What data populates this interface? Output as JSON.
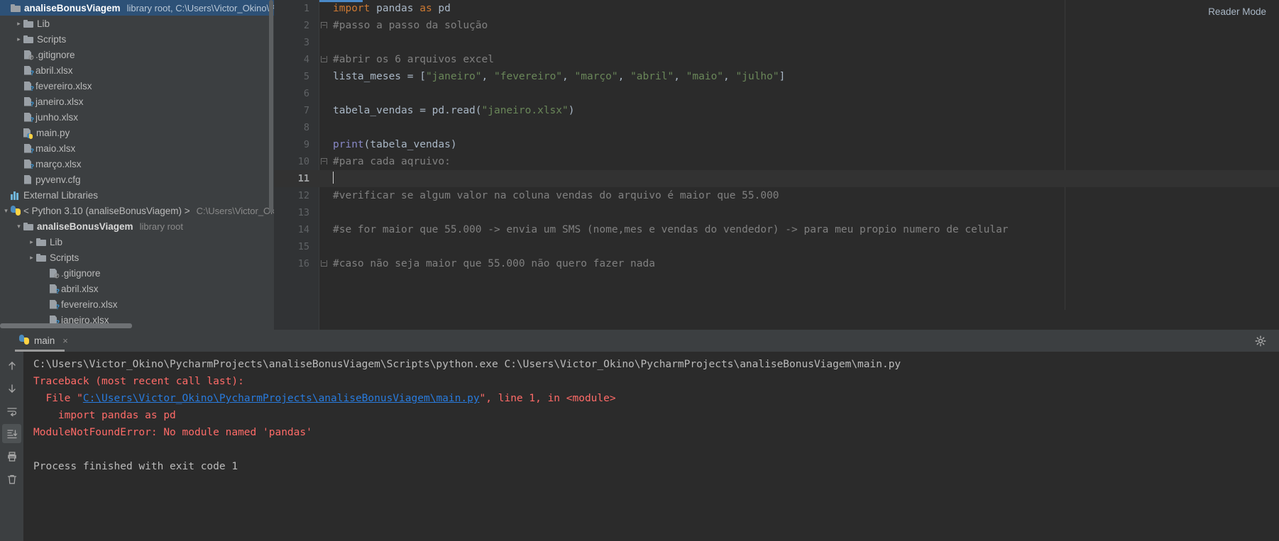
{
  "window": {
    "reader_mode_label": "Reader Mode"
  },
  "sidebar": {
    "rows": [
      {
        "id": "project-root",
        "indent": 0,
        "arrow": "",
        "icon": "folder-icon",
        "label": "analiseBonusViagem",
        "bold": true,
        "sub": "library root,  C:\\Users\\Victor_Okino\\Pycharm",
        "selected": true
      },
      {
        "id": "lib-folder",
        "indent": 1,
        "arrow": "›",
        "icon": "folder-icon",
        "label": "Lib",
        "bold": false,
        "sub": "",
        "selected": false
      },
      {
        "id": "scripts-folder",
        "indent": 1,
        "arrow": "›",
        "icon": "folder-icon",
        "label": "Scripts",
        "bold": false,
        "sub": "",
        "selected": false
      },
      {
        "id": "gitignore-file",
        "indent": 1,
        "arrow": "",
        "icon": "file-ignored-icon",
        "label": ".gitignore",
        "bold": false,
        "sub": "",
        "selected": false
      },
      {
        "id": "abril-xlsx",
        "indent": 1,
        "arrow": "",
        "icon": "file-unknown-icon",
        "label": "abril.xlsx",
        "bold": false,
        "sub": "",
        "selected": false
      },
      {
        "id": "fevereiro-xlsx",
        "indent": 1,
        "arrow": "",
        "icon": "file-unknown-icon",
        "label": "fevereiro.xlsx",
        "bold": false,
        "sub": "",
        "selected": false
      },
      {
        "id": "janeiro-xlsx",
        "indent": 1,
        "arrow": "",
        "icon": "file-unknown-icon",
        "label": "janeiro.xlsx",
        "bold": false,
        "sub": "",
        "selected": false
      },
      {
        "id": "junho-xlsx",
        "indent": 1,
        "arrow": "",
        "icon": "file-unknown-icon",
        "label": "junho.xlsx",
        "bold": false,
        "sub": "",
        "selected": false
      },
      {
        "id": "main-py",
        "indent": 1,
        "arrow": "",
        "icon": "python-file-icon",
        "label": "main.py",
        "bold": false,
        "sub": "",
        "selected": false
      },
      {
        "id": "maio-xlsx",
        "indent": 1,
        "arrow": "",
        "icon": "file-unknown-icon",
        "label": "maio.xlsx",
        "bold": false,
        "sub": "",
        "selected": false
      },
      {
        "id": "marco-xlsx",
        "indent": 1,
        "arrow": "",
        "icon": "file-unknown-icon",
        "label": "março.xlsx",
        "bold": false,
        "sub": "",
        "selected": false
      },
      {
        "id": "pyvenv-cfg",
        "indent": 1,
        "arrow": "",
        "icon": "config-file-icon",
        "label": "pyvenv.cfg",
        "bold": false,
        "sub": "",
        "selected": false
      },
      {
        "id": "external-libraries",
        "indent": 0,
        "arrow": "",
        "icon": "external-libraries-icon",
        "label": "External Libraries",
        "bold": false,
        "sub": "",
        "selected": false
      },
      {
        "id": "python-sdk",
        "indent": 0,
        "arrow": "⌄",
        "icon": "python-icon",
        "label": "< Python 3.10 (analiseBonusViagem) >",
        "bold": false,
        "sub": "C:\\Users\\Victor_Okino",
        "selected": false
      },
      {
        "id": "lib-root-analise",
        "indent": 1,
        "arrow": "⌄",
        "icon": "folder-icon",
        "label": "analiseBonusViagem",
        "bold": true,
        "sub": "library root",
        "selected": false
      },
      {
        "id": "lib-folder-2",
        "indent": 2,
        "arrow": "›",
        "icon": "folder-icon",
        "label": "Lib",
        "bold": false,
        "sub": "",
        "selected": false
      },
      {
        "id": "scripts-folder-2",
        "indent": 2,
        "arrow": "›",
        "icon": "folder-icon",
        "label": "Scripts",
        "bold": false,
        "sub": "",
        "selected": false
      },
      {
        "id": "gitignore-file-2",
        "indent": 3,
        "arrow": "",
        "icon": "file-ignored-icon",
        "label": ".gitignore",
        "bold": false,
        "sub": "",
        "selected": false
      },
      {
        "id": "abril-xlsx-2",
        "indent": 3,
        "arrow": "",
        "icon": "file-unknown-icon",
        "label": "abril.xlsx",
        "bold": false,
        "sub": "",
        "selected": false
      },
      {
        "id": "fevereiro-xlsx-2",
        "indent": 3,
        "arrow": "",
        "icon": "file-unknown-icon",
        "label": "fevereiro.xlsx",
        "bold": false,
        "sub": "",
        "selected": false
      },
      {
        "id": "janeiro-xlsx-2",
        "indent": 3,
        "arrow": "",
        "icon": "file-unknown-icon",
        "label": "janeiro.xlsx",
        "bold": false,
        "sub": "",
        "selected": false
      }
    ]
  },
  "editor": {
    "lines": [
      {
        "num": "1",
        "fold": "",
        "current": false,
        "tokens": [
          {
            "t": "import ",
            "c": "tok-kw"
          },
          {
            "t": "pandas ",
            "c": "tok-def"
          },
          {
            "t": "as ",
            "c": "tok-kw"
          },
          {
            "t": "pd",
            "c": "tok-def"
          }
        ]
      },
      {
        "num": "2",
        "fold": "down",
        "current": false,
        "tokens": [
          {
            "t": "#passo a passo da solução",
            "c": "tok-com"
          }
        ]
      },
      {
        "num": "3",
        "fold": "",
        "current": false,
        "tokens": []
      },
      {
        "num": "4",
        "fold": "up",
        "current": false,
        "tokens": [
          {
            "t": "#abrir os 6 arquivos excel",
            "c": "tok-com"
          }
        ]
      },
      {
        "num": "5",
        "fold": "",
        "current": false,
        "tokens": [
          {
            "t": "lista_meses = [",
            "c": "tok-def"
          },
          {
            "t": "\"janeiro\"",
            "c": "tok-str"
          },
          {
            "t": ", ",
            "c": "tok-def"
          },
          {
            "t": "\"fevereiro\"",
            "c": "tok-str"
          },
          {
            "t": ", ",
            "c": "tok-def"
          },
          {
            "t": "\"março\"",
            "c": "tok-str"
          },
          {
            "t": ", ",
            "c": "tok-def"
          },
          {
            "t": "\"abril\"",
            "c": "tok-str"
          },
          {
            "t": ", ",
            "c": "tok-def"
          },
          {
            "t": "\"maio\"",
            "c": "tok-str"
          },
          {
            "t": ", ",
            "c": "tok-def"
          },
          {
            "t": "\"julho\"",
            "c": "tok-str"
          },
          {
            "t": "]",
            "c": "tok-def"
          }
        ]
      },
      {
        "num": "6",
        "fold": "",
        "current": false,
        "tokens": []
      },
      {
        "num": "7",
        "fold": "",
        "current": false,
        "tokens": [
          {
            "t": "tabela_vendas = pd.read(",
            "c": "tok-def"
          },
          {
            "t": "\"janeiro.xlsx\"",
            "c": "tok-str"
          },
          {
            "t": ")",
            "c": "tok-def"
          }
        ]
      },
      {
        "num": "8",
        "fold": "",
        "current": false,
        "tokens": []
      },
      {
        "num": "9",
        "fold": "",
        "current": false,
        "tokens": [
          {
            "t": "print",
            "c": "tok-fn"
          },
          {
            "t": "(tabela_vendas)",
            "c": "tok-def"
          }
        ]
      },
      {
        "num": "10",
        "fold": "down",
        "current": false,
        "tokens": [
          {
            "t": "#para cada aqruivo:",
            "c": "tok-com"
          }
        ]
      },
      {
        "num": "11",
        "fold": "",
        "current": true,
        "tokens": [],
        "caret": true
      },
      {
        "num": "12",
        "fold": "",
        "current": false,
        "tokens": [
          {
            "t": "#verificar se algum valor na coluna vendas do arquivo é maior que 55.000",
            "c": "tok-com"
          }
        ]
      },
      {
        "num": "13",
        "fold": "",
        "current": false,
        "tokens": []
      },
      {
        "num": "14",
        "fold": "",
        "current": false,
        "tokens": [
          {
            "t": "#se for maior que 55.000 -> envia um SMS (nome,mes e vendas do vendedor) -> para meu propio numero de celular",
            "c": "tok-com"
          }
        ]
      },
      {
        "num": "15",
        "fold": "",
        "current": false,
        "tokens": []
      },
      {
        "num": "16",
        "fold": "up",
        "current": false,
        "tokens": [
          {
            "t": "#caso não seja maior que 55.000 não quero fazer nada",
            "c": "tok-com"
          }
        ]
      }
    ]
  },
  "console": {
    "tab_label": "main",
    "tab_close_label": "×",
    "toolbar": [
      {
        "id": "up-arrow-icon",
        "glyph": "↑",
        "active": false
      },
      {
        "id": "down-arrow-icon",
        "glyph": "↓",
        "active": false
      },
      {
        "id": "soft-wrap-icon",
        "glyph": "↵",
        "active": false
      },
      {
        "id": "scroll-to-end-icon",
        "glyph": "⇩",
        "active": true
      },
      {
        "id": "print-icon",
        "glyph": "⎙",
        "active": false
      },
      {
        "id": "trash-icon",
        "glyph": "Ὕ1",
        "active": false
      }
    ],
    "output": [
      {
        "id": "cmd-line",
        "segments": [
          {
            "t": "C:\\Users\\Victor_Okino\\PycharmProjects\\analiseBonusViagem\\Scripts\\python.exe C:\\Users\\Victor_Okino\\PycharmProjects\\analiseBonusViagem\\main.py",
            "c": "c-gray"
          }
        ]
      },
      {
        "id": "traceback-header",
        "segments": [
          {
            "t": "Traceback (most recent call last):",
            "c": "c-red"
          }
        ]
      },
      {
        "id": "traceback-file",
        "segments": [
          {
            "t": "  File \"",
            "c": "c-red"
          },
          {
            "t": "C:\\Users\\Victor_Okino\\PycharmProjects\\analiseBonusViagem\\main.py",
            "c": "c-link"
          },
          {
            "t": "\", line 1, in <module>",
            "c": "c-red"
          }
        ]
      },
      {
        "id": "traceback-source",
        "segments": [
          {
            "t": "    import pandas as pd",
            "c": "c-red"
          }
        ]
      },
      {
        "id": "error-message",
        "segments": [
          {
            "t": "ModuleNotFoundError: No module named 'pandas'",
            "c": "c-red"
          }
        ]
      },
      {
        "id": "blank-line",
        "segments": [
          {
            "t": " ",
            "c": "c-gray"
          }
        ]
      },
      {
        "id": "exit-status",
        "segments": [
          {
            "t": "Process finished with exit code 1",
            "c": "c-gray"
          }
        ]
      }
    ]
  },
  "colors": {
    "sidebar_bg": "#3c3f41",
    "editor_bg": "#2b2b2b",
    "gutter_bg": "#313335",
    "selection_blue": "#2d5177",
    "keyword_orange": "#cc7832",
    "string_green": "#6a8759",
    "function_blue": "#8888c6",
    "comment_gray": "#808080",
    "error_red": "#ff6b68",
    "link_blue": "#287bde",
    "tab_underline": "#4a88c7"
  }
}
